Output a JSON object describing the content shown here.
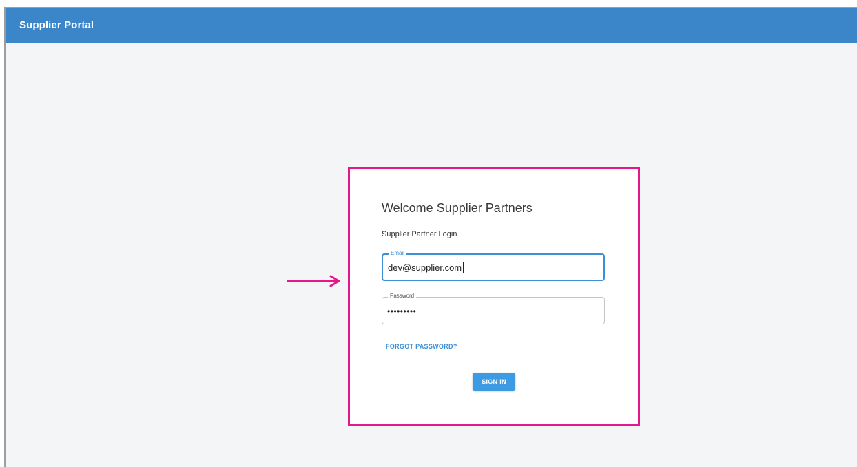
{
  "appbar": {
    "title": "Supplier Portal"
  },
  "login": {
    "title": "Welcome Supplier Partners",
    "subtitle": "Supplier Partner Login",
    "email": {
      "label": "Email",
      "value": "dev@supplier.com"
    },
    "password": {
      "label": "Password",
      "value": "•••••••••"
    },
    "forgot_label": "FORGOT PASSWORD?",
    "signin_label": "SIGN IN"
  },
  "colors": {
    "appbar": "#3a86c8",
    "accent": "#3d8fd6",
    "button": "#3d9be3",
    "annotation": "#e6168c",
    "background": "#f4f5f7"
  },
  "icons": {
    "annotation": "right-arrow-icon"
  }
}
